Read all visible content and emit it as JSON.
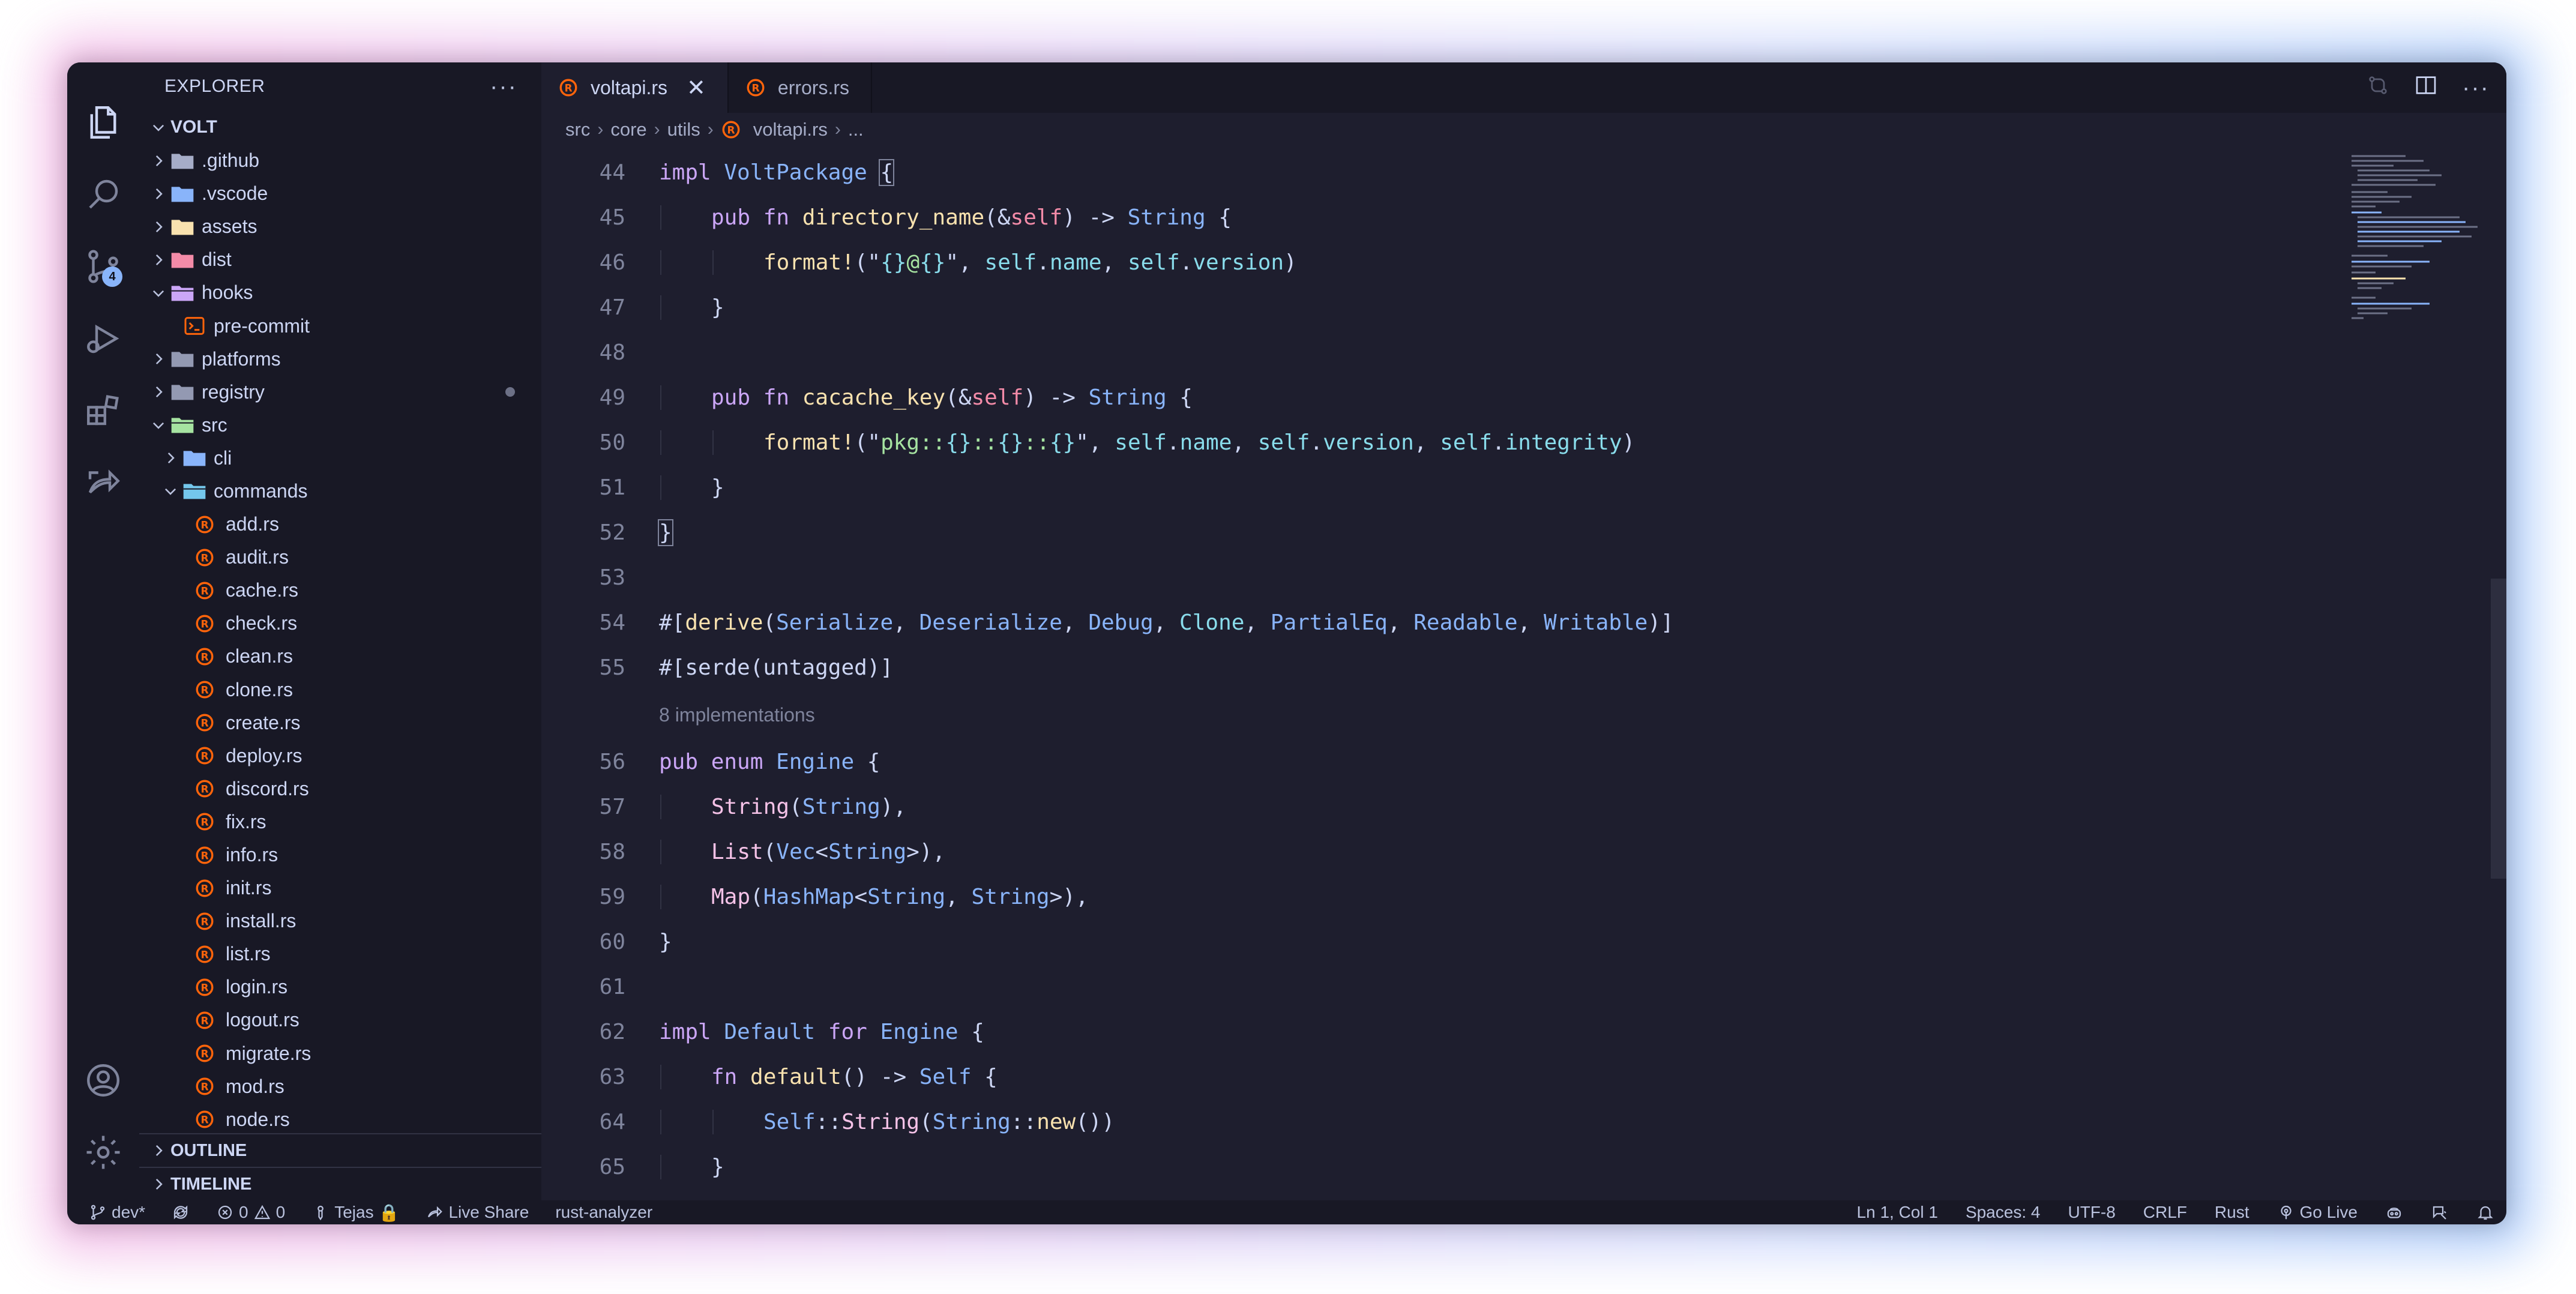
{
  "colors": {
    "background": "#1e1e2e",
    "sidebar": "#181825",
    "accent": "#89b4fa",
    "rust_icon": "#fe640b"
  },
  "sidebar": {
    "title": "EXPLORER",
    "more_icon": "ellipsis-icon",
    "root": "VOLT",
    "items": [
      {
        "label": ".github",
        "kind": "folder",
        "expanded": false,
        "icon": "github-folder-icon"
      },
      {
        "label": ".vscode",
        "kind": "folder",
        "expanded": false,
        "icon": "vscode-folder-icon"
      },
      {
        "label": "assets",
        "kind": "folder",
        "expanded": false,
        "icon": "assets-folder-icon"
      },
      {
        "label": "dist",
        "kind": "folder",
        "expanded": false,
        "icon": "dist-folder-icon"
      },
      {
        "label": "hooks",
        "kind": "folder",
        "expanded": true,
        "icon": "hooks-folder-icon"
      },
      {
        "label": "pre-commit",
        "kind": "file",
        "icon": "terminal-file-icon"
      },
      {
        "label": "platforms",
        "kind": "folder",
        "expanded": false,
        "icon": "folder-icon"
      },
      {
        "label": "registry",
        "kind": "folder",
        "expanded": false,
        "icon": "folder-icon",
        "modified": true
      },
      {
        "label": "src",
        "kind": "folder",
        "expanded": true,
        "icon": "src-folder-icon"
      },
      {
        "label": "cli",
        "kind": "folder",
        "expanded": false,
        "icon": "cli-folder-icon"
      },
      {
        "label": "commands",
        "kind": "folder",
        "expanded": true,
        "icon": "commands-folder-icon"
      },
      {
        "label": "add.rs",
        "kind": "rust"
      },
      {
        "label": "audit.rs",
        "kind": "rust"
      },
      {
        "label": "cache.rs",
        "kind": "rust"
      },
      {
        "label": "check.rs",
        "kind": "rust"
      },
      {
        "label": "clean.rs",
        "kind": "rust"
      },
      {
        "label": "clone.rs",
        "kind": "rust"
      },
      {
        "label": "create.rs",
        "kind": "rust"
      },
      {
        "label": "deploy.rs",
        "kind": "rust"
      },
      {
        "label": "discord.rs",
        "kind": "rust"
      },
      {
        "label": "fix.rs",
        "kind": "rust"
      },
      {
        "label": "info.rs",
        "kind": "rust"
      },
      {
        "label": "init.rs",
        "kind": "rust"
      },
      {
        "label": "install.rs",
        "kind": "rust"
      },
      {
        "label": "list.rs",
        "kind": "rust"
      },
      {
        "label": "login.rs",
        "kind": "rust"
      },
      {
        "label": "logout.rs",
        "kind": "rust"
      },
      {
        "label": "migrate.rs",
        "kind": "rust"
      },
      {
        "label": "mod.rs",
        "kind": "rust"
      },
      {
        "label": "node.rs",
        "kind": "rust"
      }
    ],
    "outline": "OUTLINE",
    "timeline": "TIMELINE"
  },
  "activity": {
    "source_control_badge": "4"
  },
  "tabs": [
    {
      "label": "voltapi.rs",
      "active": true
    },
    {
      "label": "errors.rs",
      "active": false
    }
  ],
  "breadcrumb": [
    "src",
    "core",
    "utils",
    "voltapi.rs",
    "..."
  ],
  "codelens": "8 implementations",
  "code": [
    {
      "n": "44",
      "indent": 0,
      "tokens": [
        [
          "kw",
          "impl "
        ],
        [
          "ty",
          "VoltPackage"
        ],
        [
          "p",
          " "
        ],
        [
          "bx",
          "{"
        ]
      ]
    },
    {
      "n": "45",
      "indent": 1,
      "tokens": [
        [
          "kw",
          "pub fn "
        ],
        [
          "fn",
          "directory_name"
        ],
        [
          "p",
          "(&"
        ],
        [
          "self",
          "self"
        ],
        [
          "p",
          ") -> "
        ],
        [
          "ty",
          "String"
        ],
        [
          "p",
          " {"
        ]
      ]
    },
    {
      "n": "46",
      "indent": 2,
      "tokens": [
        [
          "mac",
          "format!"
        ],
        [
          "p",
          "(\""
        ],
        [
          "var",
          "{}"
        ],
        [
          "str",
          "@"
        ],
        [
          "var",
          "{}"
        ],
        [
          "p",
          "\", "
        ],
        [
          "var",
          "self"
        ],
        [
          "p",
          "."
        ],
        [
          "var",
          "name"
        ],
        [
          "p",
          ", "
        ],
        [
          "var",
          "self"
        ],
        [
          "p",
          "."
        ],
        [
          "var",
          "version"
        ],
        [
          "p",
          ")"
        ]
      ]
    },
    {
      "n": "47",
      "indent": 1,
      "tokens": [
        [
          "p",
          "}"
        ]
      ]
    },
    {
      "n": "48",
      "indent": 0,
      "tokens": []
    },
    {
      "n": "49",
      "indent": 1,
      "tokens": [
        [
          "kw",
          "pub fn "
        ],
        [
          "fn",
          "cacache_key"
        ],
        [
          "p",
          "(&"
        ],
        [
          "self",
          "self"
        ],
        [
          "p",
          ") -> "
        ],
        [
          "ty",
          "String"
        ],
        [
          "p",
          " {"
        ]
      ]
    },
    {
      "n": "50",
      "indent": 2,
      "tokens": [
        [
          "mac",
          "format!"
        ],
        [
          "p",
          "(\""
        ],
        [
          "str",
          "pkg::"
        ],
        [
          "var",
          "{}"
        ],
        [
          "str",
          "::"
        ],
        [
          "var",
          "{}"
        ],
        [
          "str",
          "::"
        ],
        [
          "var",
          "{}"
        ],
        [
          "p",
          "\", "
        ],
        [
          "var",
          "self"
        ],
        [
          "p",
          "."
        ],
        [
          "var",
          "name"
        ],
        [
          "p",
          ", "
        ],
        [
          "var",
          "self"
        ],
        [
          "p",
          "."
        ],
        [
          "var",
          "version"
        ],
        [
          "p",
          ", "
        ],
        [
          "var",
          "self"
        ],
        [
          "p",
          "."
        ],
        [
          "var",
          "integrity"
        ],
        [
          "p",
          ")"
        ]
      ]
    },
    {
      "n": "51",
      "indent": 1,
      "tokens": [
        [
          "p",
          "}"
        ]
      ]
    },
    {
      "n": "52",
      "indent": 0,
      "tokens": [
        [
          "bx",
          "}"
        ]
      ]
    },
    {
      "n": "53",
      "indent": 0,
      "tokens": []
    },
    {
      "n": "54",
      "indent": 0,
      "tokens": [
        [
          "p",
          "#["
        ],
        [
          "fn",
          "derive"
        ],
        [
          "p",
          "("
        ],
        [
          "ty",
          "Serialize"
        ],
        [
          "p",
          ", "
        ],
        [
          "ty",
          "Deserialize"
        ],
        [
          "p",
          ", "
        ],
        [
          "ty",
          "Debug"
        ],
        [
          "p",
          ", "
        ],
        [
          "var",
          "Clone"
        ],
        [
          "p",
          ", "
        ],
        [
          "ty",
          "PartialEq"
        ],
        [
          "p",
          ", "
        ],
        [
          "ty",
          "Readable"
        ],
        [
          "p",
          ", "
        ],
        [
          "ty",
          "Writable"
        ],
        [
          "p",
          ")]"
        ]
      ]
    },
    {
      "n": "55",
      "indent": 0,
      "tokens": [
        [
          "p",
          "#["
        ],
        [
          "p",
          "serde(untagged)"
        ],
        [
          "p",
          "]"
        ]
      ]
    },
    {
      "lens": true
    },
    {
      "n": "56",
      "indent": 0,
      "tokens": [
        [
          "kw",
          "pub enum "
        ],
        [
          "ty",
          "Engine"
        ],
        [
          "p",
          " {"
        ]
      ]
    },
    {
      "n": "57",
      "indent": 1,
      "tokens": [
        [
          "en",
          "String"
        ],
        [
          "p",
          "("
        ],
        [
          "ty",
          "String"
        ],
        [
          "p",
          "),"
        ]
      ]
    },
    {
      "n": "58",
      "indent": 1,
      "tokens": [
        [
          "en",
          "List"
        ],
        [
          "p",
          "("
        ],
        [
          "ty",
          "Vec"
        ],
        [
          "p",
          "<"
        ],
        [
          "ty",
          "String"
        ],
        [
          "p",
          ">),"
        ]
      ]
    },
    {
      "n": "59",
      "indent": 1,
      "tokens": [
        [
          "en",
          "Map"
        ],
        [
          "p",
          "("
        ],
        [
          "ty",
          "HashMap"
        ],
        [
          "p",
          "<"
        ],
        [
          "ty",
          "String"
        ],
        [
          "p",
          ", "
        ],
        [
          "ty",
          "String"
        ],
        [
          "p",
          ">),"
        ]
      ]
    },
    {
      "n": "60",
      "indent": 0,
      "tokens": [
        [
          "p",
          "}"
        ]
      ]
    },
    {
      "n": "61",
      "indent": 0,
      "tokens": []
    },
    {
      "n": "62",
      "indent": 0,
      "tokens": [
        [
          "kw",
          "impl "
        ],
        [
          "ty",
          "Default"
        ],
        [
          "kw",
          " for "
        ],
        [
          "ty",
          "Engine"
        ],
        [
          "p",
          " {"
        ]
      ]
    },
    {
      "n": "63",
      "indent": 1,
      "tokens": [
        [
          "kw",
          "fn "
        ],
        [
          "fn",
          "default"
        ],
        [
          "p",
          "() -> "
        ],
        [
          "ty",
          "Self"
        ],
        [
          "p",
          " {"
        ]
      ]
    },
    {
      "n": "64",
      "indent": 2,
      "tokens": [
        [
          "ty",
          "Self"
        ],
        [
          "p",
          "::"
        ],
        [
          "en",
          "String"
        ],
        [
          "p",
          "("
        ],
        [
          "ty",
          "String"
        ],
        [
          "p",
          "::"
        ],
        [
          "fn",
          "new"
        ],
        [
          "p",
          "())"
        ]
      ]
    },
    {
      "n": "65",
      "indent": 1,
      "tokens": [
        [
          "p",
          "}"
        ]
      ]
    }
  ],
  "status": {
    "branch": "dev*",
    "errors": "0",
    "warnings": "0",
    "user": "Tejas",
    "live_share": "Live Share",
    "analyzer": "rust-analyzer",
    "position": "Ln 1, Col 1",
    "spaces": "Spaces: 4",
    "encoding": "UTF-8",
    "eol": "CRLF",
    "language": "Rust",
    "go_live": "Go Live"
  }
}
